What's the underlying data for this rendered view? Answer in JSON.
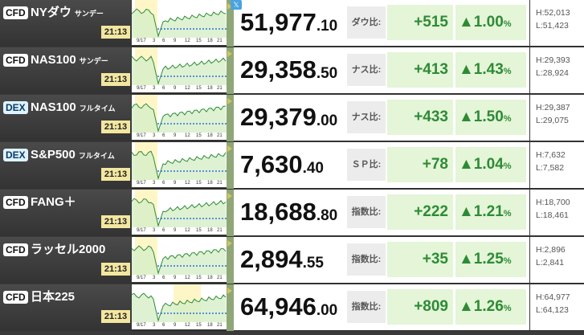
{
  "colors": {
    "up": "#2e8b35",
    "chart_line": "#2e8b35",
    "baseline": "#2e6fd6",
    "session": "#fff6c8"
  },
  "share_icon": "twitter-icon",
  "tick_labels": [
    "9/17",
    "3",
    "6",
    "9",
    "12",
    "15",
    "18",
    "21"
  ],
  "rows": [
    {
      "badge": "CFD",
      "name": "NYダウ",
      "sub": "サンデー",
      "time": "21:13",
      "price_int": "51,977",
      "price_dec": ".10",
      "label": "ダウ比:",
      "change": "+515",
      "pct": "▲1.00",
      "pct_unit": "%",
      "high": "H:52,013",
      "low": "L:51,423",
      "dex": false
    },
    {
      "badge": "CFD",
      "name": "NAS100",
      "sub": "サンデー",
      "time": "21:13",
      "price_int": "29,358",
      "price_dec": ".50",
      "label": "ナス比:",
      "change": "+413",
      "pct": "▲1.43",
      "pct_unit": "%",
      "high": "H:29,393",
      "low": "L:28,924",
      "dex": false
    },
    {
      "badge": "DEX",
      "name": "NAS100",
      "sub": "フルタイム",
      "time": "21:13",
      "price_int": "29,379",
      "price_dec": ".00",
      "label": "ナス比:",
      "change": "+433",
      "pct": "▲1.50",
      "pct_unit": "%",
      "high": "H:29,387",
      "low": "L:29,075",
      "dex": true
    },
    {
      "badge": "DEX",
      "name": "S&P500",
      "sub": "フルタイム",
      "time": "21:13",
      "price_int": "7,630",
      "price_dec": ".40",
      "label": "ＳＰ比:",
      "change": "+78",
      "pct": "▲1.04",
      "pct_unit": "%",
      "high": "H:7,632",
      "low": "L:7,582",
      "dex": true
    },
    {
      "badge": "CFD",
      "name": "FANG＋",
      "sub": "",
      "time": "21:13",
      "price_int": "18,688",
      "price_dec": ".80",
      "label": "指数比:",
      "change": "+222",
      "pct": "▲1.21",
      "pct_unit": "%",
      "high": "H:18,700",
      "low": "L:18,461",
      "dex": false
    },
    {
      "badge": "CFD",
      "name": "ラッセル2000",
      "sub": "",
      "time": "21:13",
      "price_int": "2,894",
      "price_dec": ".55",
      "label": "指数比:",
      "change": "+35",
      "pct": "▲1.25",
      "pct_unit": "%",
      "high": "H:2,896",
      "low": "L:2,841",
      "dex": false
    },
    {
      "badge": "CFD",
      "name": "日本225",
      "sub": "",
      "time": "21:13",
      "price_int": "64,946",
      "price_dec": ".00",
      "label": "指数比:",
      "change": "+809",
      "pct": "▲1.26",
      "pct_unit": "%",
      "high": "H:64,977",
      "low": "L:64,123",
      "dex": false
    }
  ]
}
